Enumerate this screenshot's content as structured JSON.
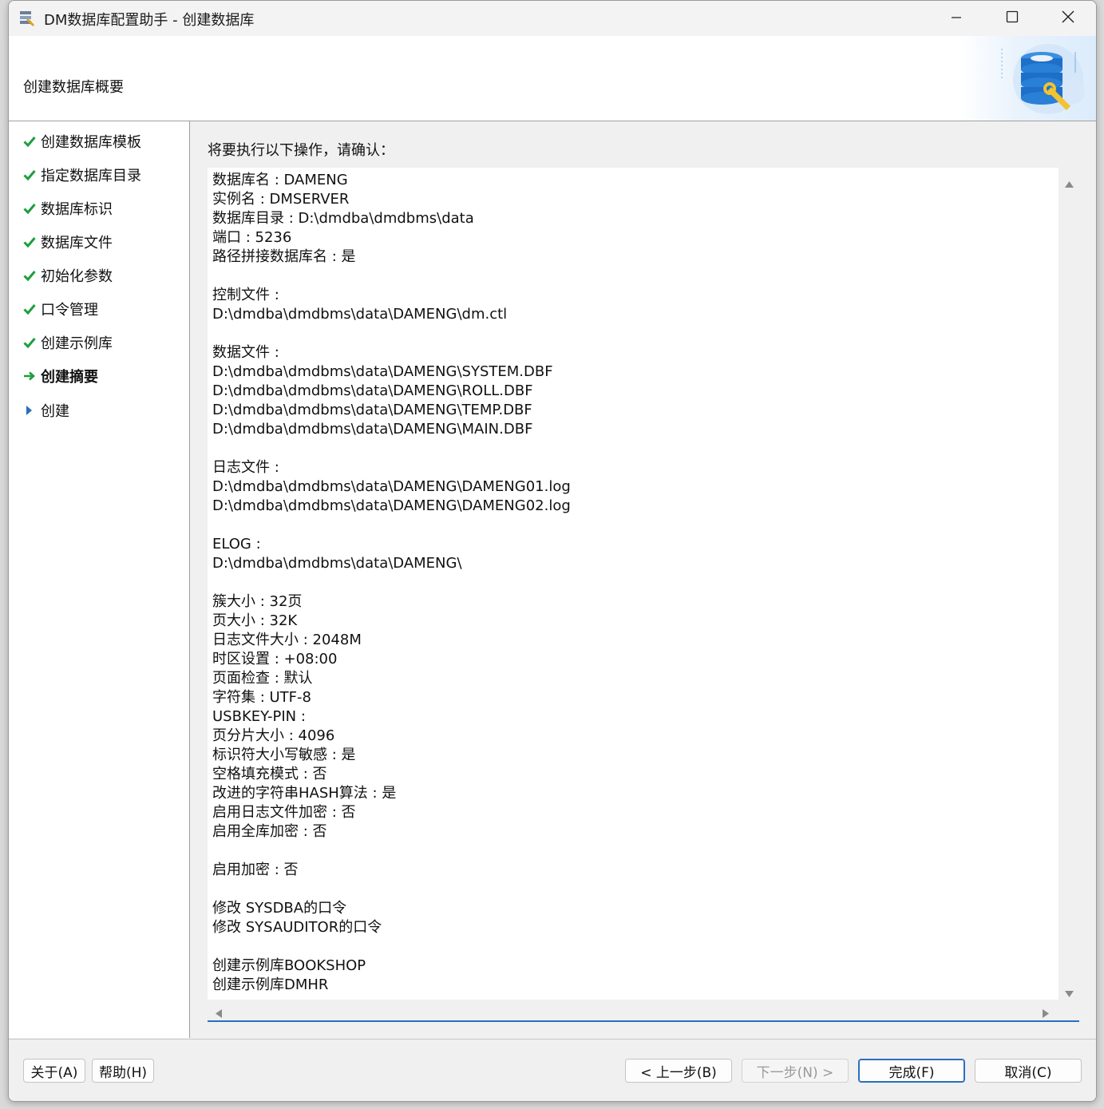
{
  "window": {
    "title": "DM数据库配置助手 - 创建数据库"
  },
  "header": {
    "title": "创建数据库概要"
  },
  "steps": [
    {
      "label": "创建数据库模板",
      "status": "done"
    },
    {
      "label": "指定数据库目录",
      "status": "done"
    },
    {
      "label": "数据库标识",
      "status": "done"
    },
    {
      "label": "数据库文件",
      "status": "done"
    },
    {
      "label": "初始化参数",
      "status": "done"
    },
    {
      "label": "口令管理",
      "status": "done"
    },
    {
      "label": "创建示例库",
      "status": "done"
    },
    {
      "label": "创建摘要",
      "status": "current"
    },
    {
      "label": "创建",
      "status": "pending"
    }
  ],
  "main": {
    "prompt": "将要执行以下操作，请确认：",
    "summary_lines": [
      "数据库名 : DAMENG",
      "实例名 : DMSERVER",
      "数据库目录 : D:\\dmdba\\dmdbms\\data",
      "端口 : 5236",
      "路径拼接数据库名 : 是",
      "",
      "控制文件 :",
      "D:\\dmdba\\dmdbms\\data\\DAMENG\\dm.ctl",
      "",
      "数据文件 :",
      "D:\\dmdba\\dmdbms\\data\\DAMENG\\SYSTEM.DBF",
      "D:\\dmdba\\dmdbms\\data\\DAMENG\\ROLL.DBF",
      "D:\\dmdba\\dmdbms\\data\\DAMENG\\TEMP.DBF",
      "D:\\dmdba\\dmdbms\\data\\DAMENG\\MAIN.DBF",
      "",
      "日志文件 :",
      "D:\\dmdba\\dmdbms\\data\\DAMENG\\DAMENG01.log",
      "D:\\dmdba\\dmdbms\\data\\DAMENG\\DAMENG02.log",
      "",
      "ELOG :",
      "D:\\dmdba\\dmdbms\\data\\DAMENG\\",
      "",
      "簇大小 : 32页",
      "页大小 : 32K",
      "日志文件大小 : 2048M",
      "时区设置 : +08:00",
      "页面检查 : 默认",
      "字符集 : UTF-8",
      "USBKEY-PIN :",
      "页分片大小 : 4096",
      "标识符大小写敏感 : 是",
      "空格填充模式 : 否",
      "改进的字符串HASH算法 : 是",
      "启用日志文件加密 : 否",
      "启用全库加密 : 否",
      "",
      "启用加密 : 否",
      "",
      "修改 SYSDBA的口令",
      "修改 SYSAUDITOR的口令",
      "",
      "创建示例库BOOKSHOP",
      "创建示例库DMHR"
    ]
  },
  "buttons": {
    "about": "关于(A)",
    "help": "帮助(H)",
    "back": "< 上一步(B)",
    "next": "下一步(N) >",
    "finish": "完成(F)",
    "cancel": "取消(C)"
  },
  "colors": {
    "check": "#1e9e3c",
    "arrow_current": "#1e9e3c",
    "arrow_pending": "#2a6ebf",
    "accent": "#2a6ebf"
  },
  "icons": {
    "app": "database-tool-icon",
    "header": "database-wrench-icon",
    "minimize": "minimize-icon",
    "maximize": "maximize-icon",
    "close": "close-icon"
  }
}
